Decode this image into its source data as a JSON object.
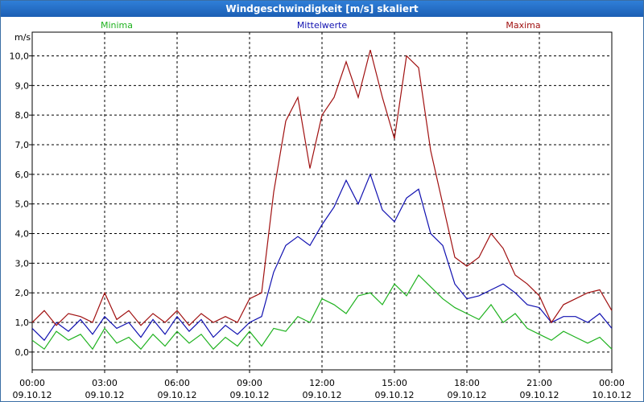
{
  "window": {
    "title": "Windgeschwindigkeit [m/s] skaliert"
  },
  "chart_data": {
    "type": "line",
    "ylabel": "m/s",
    "ylim": [
      -0.6,
      10.8
    ],
    "xlim": [
      0,
      24
    ],
    "grid": true,
    "legend_placement": "top",
    "y_ticks": [
      "0,0",
      "1,0",
      "2,0",
      "3,0",
      "4,0",
      "5,0",
      "6,0",
      "7,0",
      "8,0",
      "9,0",
      "10,0"
    ],
    "x_ticks": [
      {
        "time": "00:00",
        "date": "09.10.12"
      },
      {
        "time": "03:00",
        "date": "09.10.12"
      },
      {
        "time": "06:00",
        "date": "09.10.12"
      },
      {
        "time": "09:00",
        "date": "09.10.12"
      },
      {
        "time": "12:00",
        "date": "09.10.12"
      },
      {
        "time": "15:00",
        "date": "09.10.12"
      },
      {
        "time": "18:00",
        "date": "09.10.12"
      },
      {
        "time": "21:00",
        "date": "09.10.12"
      },
      {
        "time": "00:00",
        "date": "10.10.12"
      }
    ],
    "series": [
      {
        "name": "Minima",
        "color": "#1fb21f",
        "x": [
          0,
          0.5,
          1,
          1.5,
          2,
          2.5,
          3,
          3.5,
          4,
          4.5,
          5,
          5.5,
          6,
          6.5,
          7,
          7.5,
          8,
          8.5,
          9,
          9.5,
          10,
          10.5,
          11,
          11.5,
          12,
          12.5,
          13,
          13.5,
          14,
          14.5,
          15,
          15.5,
          16,
          16.5,
          17,
          17.5,
          18,
          18.5,
          19,
          19.5,
          20,
          20.5,
          21,
          21.5,
          22,
          22.5,
          23,
          23.5,
          24
        ],
        "values": [
          0.4,
          0.1,
          0.7,
          0.4,
          0.6,
          0.1,
          0.8,
          0.3,
          0.5,
          0.1,
          0.6,
          0.2,
          0.7,
          0.3,
          0.6,
          0.1,
          0.5,
          0.2,
          0.7,
          0.2,
          0.8,
          0.7,
          1.2,
          1.0,
          1.8,
          1.6,
          1.3,
          1.9,
          2.0,
          1.6,
          2.3,
          1.9,
          2.6,
          2.2,
          1.8,
          1.5,
          1.3,
          1.1,
          1.6,
          1.0,
          1.3,
          0.8,
          0.6,
          0.4,
          0.7,
          0.5,
          0.3,
          0.5,
          0.1
        ]
      },
      {
        "name": "Mittelwerte",
        "color": "#1010b0",
        "x": [
          0,
          0.5,
          1,
          1.5,
          2,
          2.5,
          3,
          3.5,
          4,
          4.5,
          5,
          5.5,
          6,
          6.5,
          7,
          7.5,
          8,
          8.5,
          9,
          9.5,
          10,
          10.5,
          11,
          11.5,
          12,
          12.5,
          13,
          13.5,
          14,
          14.5,
          15,
          15.5,
          16,
          16.5,
          17,
          17.5,
          18,
          18.5,
          19,
          19.5,
          20,
          20.5,
          21,
          21.5,
          22,
          22.5,
          23,
          23.5,
          24
        ],
        "values": [
          0.8,
          0.4,
          1.0,
          0.7,
          1.1,
          0.6,
          1.2,
          0.8,
          1.0,
          0.5,
          1.1,
          0.6,
          1.2,
          0.7,
          1.1,
          0.5,
          0.9,
          0.6,
          1.0,
          1.2,
          2.7,
          3.6,
          3.9,
          3.6,
          4.3,
          4.9,
          5.8,
          5.0,
          6.0,
          4.8,
          4.4,
          5.2,
          5.5,
          4.0,
          3.6,
          2.3,
          1.8,
          1.9,
          2.1,
          2.3,
          2.0,
          1.6,
          1.5,
          1.0,
          1.2,
          1.2,
          1.0,
          1.3,
          0.8
        ]
      },
      {
        "name": "Maxima",
        "color": "#a01010",
        "x": [
          0,
          0.5,
          1,
          1.5,
          2,
          2.5,
          3,
          3.5,
          4,
          4.5,
          5,
          5.5,
          6,
          6.5,
          7,
          7.5,
          8,
          8.5,
          9,
          9.5,
          10,
          10.5,
          11,
          11.5,
          12,
          12.5,
          13,
          13.5,
          14,
          14.5,
          15,
          15.5,
          16,
          16.5,
          17,
          17.5,
          18,
          18.5,
          19,
          19.5,
          20,
          20.5,
          21,
          21.5,
          22,
          22.5,
          23,
          23.5,
          24
        ],
        "values": [
          1.0,
          1.4,
          0.9,
          1.3,
          1.2,
          1.0,
          2.0,
          1.1,
          1.4,
          0.9,
          1.3,
          1.0,
          1.4,
          0.9,
          1.3,
          1.0,
          1.2,
          1.0,
          1.8,
          2.0,
          5.4,
          7.8,
          8.6,
          6.2,
          8.0,
          8.6,
          9.8,
          8.6,
          10.2,
          8.6,
          7.2,
          10.0,
          9.6,
          6.8,
          5.0,
          3.2,
          2.9,
          3.2,
          4.0,
          3.5,
          2.6,
          2.3,
          1.9,
          1.0,
          1.6,
          1.8,
          2.0,
          2.1,
          1.4
        ]
      }
    ]
  }
}
